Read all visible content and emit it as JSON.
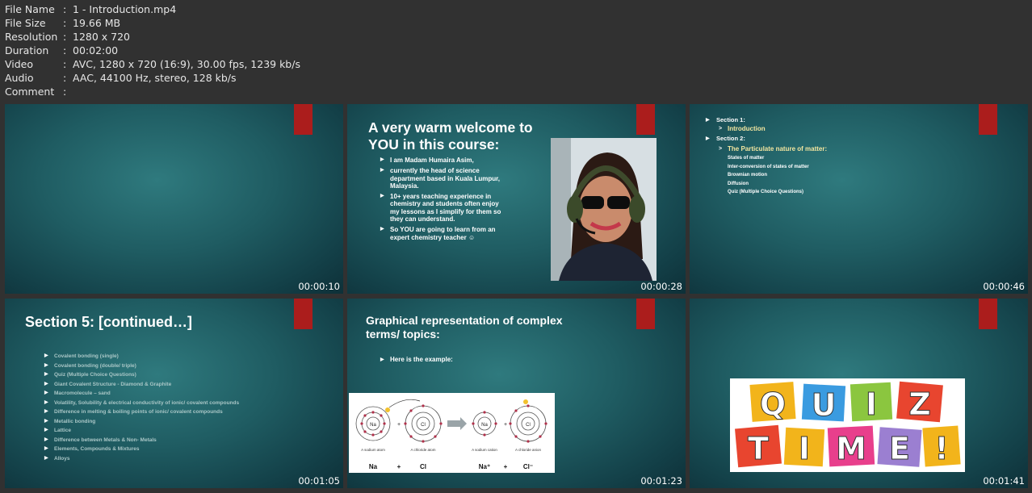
{
  "file_info": [
    {
      "key": "File Name",
      "value": "1 - Introduction.mp4"
    },
    {
      "key": "File Size",
      "value": "19.66 MB"
    },
    {
      "key": "Resolution",
      "value": "1280 x 720"
    },
    {
      "key": "Duration",
      "value": "00:02:00"
    },
    {
      "key": "Video",
      "value": "AVC, 1280 x 720 (16:9), 30.00 fps, 1239 kb/s"
    },
    {
      "key": "Audio",
      "value": "AAC, 44100 Hz, stereo, 128 kb/s"
    },
    {
      "key": "Comment",
      "value": ""
    }
  ],
  "separator": ":",
  "colors": {
    "background": "#313131",
    "slide_teal": "#1f5c62",
    "red_tab": "#ab1d1c",
    "highlight": "#f3e6a0"
  },
  "thumbnails": [
    {
      "timestamp": "00:00:10"
    },
    {
      "timestamp": "00:00:28",
      "title": "A very warm welcome to YOU in this course:",
      "bullets": [
        "I am Madam Humaira Asim,",
        "currently the head of science department based in Kuala Lumpur, Malaysia.",
        "10+ years teaching experience in chemistry and students often enjoy my lessons as I simplify for them so they can understand.",
        "So YOU are going to learn from an expert chemistry teacher ☺"
      ]
    },
    {
      "timestamp": "00:00:46",
      "section1": "Section 1:",
      "section1_item": "Introduction",
      "section2": "Section 2:",
      "section2_heading": "The Particulate nature of matter:",
      "section2_items": [
        "States of matter",
        "Inter-conversion of states of matter",
        "Brownian motion",
        "Diffusion",
        "Quiz (Multiple Choice Questions)"
      ]
    },
    {
      "timestamp": "00:01:05",
      "title": "Section 5: [continued…]",
      "items": [
        "Covalent bonding (single)",
        "Covalent bonding (double/ triple)",
        "Quiz (Multiple Choice Questions)",
        "Giant Covalent Structure - Diamond & Graphite",
        "Macromolecule – sand",
        "Volatility, Solubility & electrical conductivity of ionic/ covalent compounds",
        "Difference in melting & boiling points of ionic/ covalent compounds",
        "Metallic bonding",
        "Lattice",
        "Difference between Metals & Non- Metals",
        "Elements, Compounds & Mixtures",
        "Alloys"
      ]
    },
    {
      "timestamp": "00:01:23",
      "title": "Graphical representation of complex terms/ topics:",
      "bullet": "Here is the example:",
      "diagram": {
        "atoms": [
          "Na",
          "Cl",
          "Na",
          "Cl"
        ],
        "captions": [
          "A sodium atom",
          "A chloride atom",
          "A sodium cation",
          "A chloride anion"
        ],
        "equation": [
          "Na",
          "+",
          "Cl",
          "Na⁺",
          "+",
          "Cl⁻"
        ]
      }
    },
    {
      "timestamp": "00:01:41",
      "quiz_row1": [
        "Q",
        "U",
        "I",
        "Z"
      ],
      "quiz_row2": [
        "T",
        "I",
        "M",
        "E",
        "!"
      ],
      "quiz_colors": [
        "#f2b41b",
        "#3a9be0",
        "#8bc63f",
        "#e8452f",
        "#e8452f",
        "#f2b41b",
        "#e83f8c",
        "#9b7fd1",
        "#f2b41b"
      ]
    }
  ]
}
